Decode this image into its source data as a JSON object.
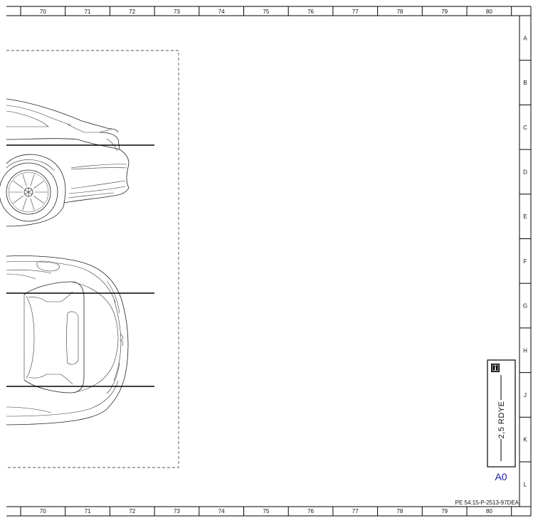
{
  "ruler": {
    "columns": [
      "70",
      "71",
      "72",
      "73",
      "74",
      "75",
      "76",
      "77",
      "78",
      "79",
      "80"
    ],
    "rows": [
      "A",
      "B",
      "C",
      "D",
      "E",
      "F",
      "G",
      "H",
      "J",
      "K",
      "L"
    ]
  },
  "component": {
    "wire_label": "2,5 RDYE",
    "connector_label": "A0",
    "connector_color": "#1a1aaa"
  },
  "document_id": "PE 54.15-P-2513-97DEA"
}
